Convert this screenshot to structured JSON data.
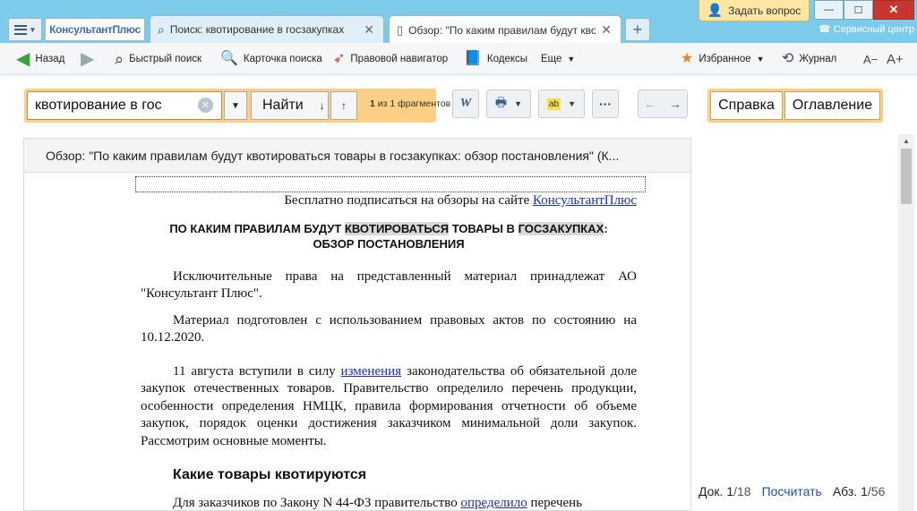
{
  "app": {
    "logo": "КонсультантПлюс",
    "ask_button": "Задать вопрос",
    "service_center": "Сервисный центр"
  },
  "tabs": [
    {
      "label": "Поиск: квотирование в госзакупках",
      "active": false
    },
    {
      "label": "Обзор: \"По каким правилам будут квоти",
      "active": true
    }
  ],
  "toolbar": {
    "back": "Назад",
    "quick_search": "Быстрый поиск",
    "search_card": "Карточка поиска",
    "legal_navigator": "Правовой навигатор",
    "codes": "Кодексы",
    "more": "Еще",
    "favorites": "Избранное",
    "journal": "Журнал",
    "font_smaller": "A−",
    "font_larger": "A+"
  },
  "search": {
    "query": "квотирование в гос",
    "find_label": "Найти",
    "fragments_current": "1",
    "fragments_text": "из 1 фрагментов"
  },
  "right_buttons": {
    "help": "Справка",
    "contents": "Оглавление"
  },
  "document": {
    "header": "Обзор: \"По каким правилам будут квотироваться товары в госзакупках: обзор постановления\" (К...",
    "subscribe_text": "Бесплатно подписаться на обзоры на сайте ",
    "subscribe_link": "КонсультантПлюс",
    "title_part1": "ПО КАКИМ ПРАВИЛАМ БУДУТ ",
    "title_hl1": "КВОТИРОВАТЬСЯ",
    "title_part2": " ТОВАРЫ В ",
    "title_hl2": "ГОСЗАКУПКАХ",
    "title_part3": ":",
    "title_line2": "ОБЗОР ПОСТАНОВЛЕНИЯ",
    "para1": "Исключительные права на представленный материал принадлежат АО \"Консультант Плюс\".",
    "para2": "Материал подготовлен с использованием правовых актов по состоянию на 10.12.2020.",
    "para3_a": "11 августа вступили в силу ",
    "para3_link": "изменения",
    "para3_b": " законодательства об обязательной доле закупок отечественных товаров. Правительство определило перечень продукции, особенности определения НМЦК, правила формирования отчетности об объеме закупок, порядок оценки достижения заказчиком минимальной доли закупок. Рассмотрим основные моменты.",
    "heading": "Какие товары квотируются",
    "para4_a": "Для заказчиков по Закону N 44-ФЗ правительство ",
    "para4_link": "определило",
    "para4_b": " перечень"
  },
  "status": {
    "doc_label": "Док. 1",
    "doc_total": "/18",
    "count": "Посчитать",
    "para_label": "Абз. 1",
    "para_total": "/56"
  }
}
